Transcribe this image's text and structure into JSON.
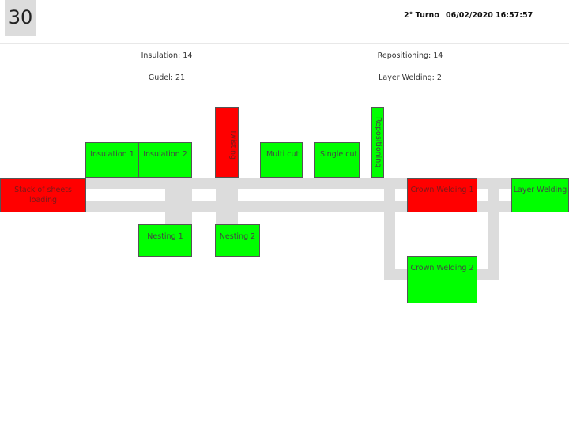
{
  "header": {
    "counter": "30",
    "shift": "2° Turno",
    "date": "06/02/2020",
    "time": "16:57:57"
  },
  "info": {
    "insulation": "Insulation: 14",
    "repositioning": "Repositioning: 14",
    "gudel": "Gudel: 21",
    "layer_welding": "Layer Welding: 2"
  },
  "colors": {
    "ok": "#00ff00",
    "alarm": "#ff0000",
    "track": "#dcdcdc"
  },
  "stations": {
    "stack_loading": {
      "label": "Stack of sheets loading",
      "status": "alarm"
    },
    "insulation_1": {
      "label": "Insulation 1",
      "status": "ok"
    },
    "insulation_2": {
      "label": "Insulation 2",
      "status": "ok"
    },
    "twisting": {
      "label": "Twisting",
      "status": "alarm"
    },
    "multi_cut": {
      "label": "Multi cut",
      "status": "ok"
    },
    "single_cut": {
      "label": "Single cut",
      "status": "ok"
    },
    "repositioning": {
      "label": "Repositioning",
      "status": "ok"
    },
    "crown_welding_1": {
      "label": "Crown Welding 1",
      "status": "alarm"
    },
    "layer_welding": {
      "label": "Layer Welding",
      "status": "ok"
    },
    "nesting_1": {
      "label": "Nesting 1",
      "status": "ok"
    },
    "nesting_2": {
      "label": "Nesting 2",
      "status": "ok"
    },
    "crown_welding_2": {
      "label": "Crown Welding 2",
      "status": "ok"
    }
  }
}
